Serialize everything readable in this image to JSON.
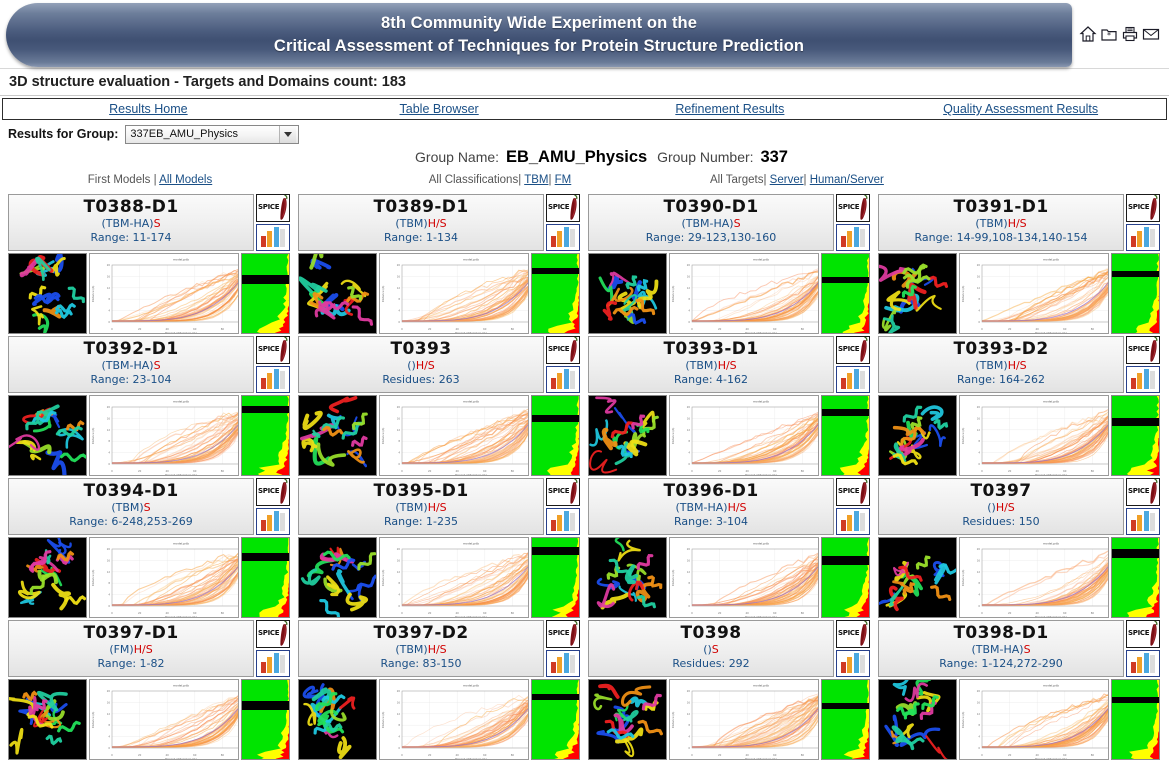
{
  "banner": {
    "title_line1": "8th Community Wide Experiment on the",
    "title_line2": "Critical Assessment of Techniques for Protein Structure Prediction",
    "icons": [
      "home-icon",
      "new-folder-icon",
      "print-icon",
      "mail-icon"
    ],
    "gradient_top": "#93a1b8",
    "gradient_mid": "#3f5072",
    "gradient_bottom": "#8a98b1"
  },
  "subtitle": "3D structure evaluation - Targets and Domains count: 183",
  "nav": [
    {
      "label": "Results Home"
    },
    {
      "label": "Table Browser"
    },
    {
      "label": "Refinement Results"
    },
    {
      "label": "Quality Assessment Results"
    }
  ],
  "group_selector": {
    "label": "Results for Group:",
    "selected": "337EB_AMU_Physics"
  },
  "group_info": {
    "name_key": "Group Name:",
    "name_value": "EB_AMU_Physics",
    "number_key": "Group Number:",
    "number_value": "337"
  },
  "filters": {
    "models": {
      "current": "First Models",
      "sep": " | ",
      "link": "All Models"
    },
    "classifications": {
      "current": "All Classifications",
      "sep": "| ",
      "links": [
        "TBM",
        "FM"
      ]
    },
    "targets": {
      "current": "All Targets",
      "sep": "| ",
      "links": [
        "Server",
        "Human/Server"
      ]
    }
  },
  "accent_colors": {
    "link": "#1a4f86",
    "class_text": "#1a4f86",
    "type_text": "#d10000",
    "bar_green": "#00e400",
    "bar_yellow": "#ffff00",
    "bar_red": "#ff0000",
    "plot_curve": "#f5a24b"
  },
  "card_icons": {
    "spice_label": "SPICE",
    "spice_name": "spice-viewer-icon",
    "chart_name": "score-chart-icon"
  },
  "cards": [
    {
      "target": "T0388-D1",
      "classification": "(TBM-HA)",
      "type": "S",
      "meta_key": "Range:",
      "meta_value": "11-174"
    },
    {
      "target": "T0389-D1",
      "classification": "(TBM)",
      "type": "H/S",
      "meta_key": "Range:",
      "meta_value": "1-134"
    },
    {
      "target": "T0390-D1",
      "classification": "(TBM-HA)",
      "type": "S",
      "meta_key": "Range:",
      "meta_value": "29-123,130-160"
    },
    {
      "target": "T0391-D1",
      "classification": "(TBM)",
      "type": "H/S",
      "meta_key": "Range:",
      "meta_value": "14-99,108-134,140-154"
    },
    {
      "target": "T0392-D1",
      "classification": "(TBM-HA)",
      "type": "S",
      "meta_key": "Range:",
      "meta_value": "23-104"
    },
    {
      "target": "T0393",
      "classification": "()",
      "type": "H/S",
      "meta_key": "Residues:",
      "meta_value": "263"
    },
    {
      "target": "T0393-D1",
      "classification": "(TBM)",
      "type": "H/S",
      "meta_key": "Range:",
      "meta_value": "4-162"
    },
    {
      "target": "T0393-D2",
      "classification": "(TBM)",
      "type": "H/S",
      "meta_key": "Range:",
      "meta_value": "164-262"
    },
    {
      "target": "T0394-D1",
      "classification": "(TBM)",
      "type": "S",
      "meta_key": "Range:",
      "meta_value": "6-248,253-269"
    },
    {
      "target": "T0395-D1",
      "classification": "(TBM)",
      "type": "H/S",
      "meta_key": "Range:",
      "meta_value": "1-235"
    },
    {
      "target": "T0396-D1",
      "classification": "(TBM-HA)",
      "type": "H/S",
      "meta_key": "Range:",
      "meta_value": "3-104"
    },
    {
      "target": "T0397",
      "classification": "()",
      "type": "H/S",
      "meta_key": "Residues:",
      "meta_value": "150"
    },
    {
      "target": "T0397-D1",
      "classification": "(FM)",
      "type": "H/S",
      "meta_key": "Range:",
      "meta_value": "1-82"
    },
    {
      "target": "T0397-D2",
      "classification": "(TBM)",
      "type": "H/S",
      "meta_key": "Range:",
      "meta_value": "83-150"
    },
    {
      "target": "T0398",
      "classification": "()",
      "type": "S",
      "meta_key": "Residues:",
      "meta_value": "292"
    },
    {
      "target": "T0398-D1",
      "classification": "(TBM-HA)",
      "type": "S",
      "meta_key": "Range:",
      "meta_value": "1-124,272-290"
    }
  ]
}
